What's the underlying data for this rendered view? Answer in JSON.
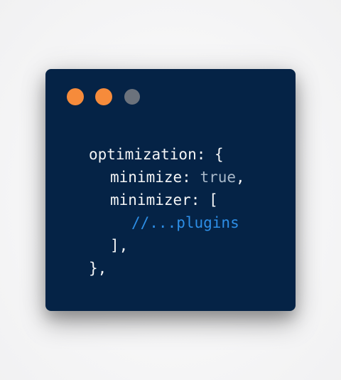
{
  "window": {
    "dots": [
      {
        "name": "orange-dot-1",
        "color": "#f68b3b"
      },
      {
        "name": "orange-dot-2",
        "color": "#f68b3b"
      },
      {
        "name": "gray-dot",
        "color": "#6b727c"
      }
    ]
  },
  "code": {
    "line1": "optimization: {",
    "line2_key": "minimize: ",
    "line2_value": "true",
    "line2_end": ",",
    "line3": "minimizer: [",
    "line4": "//...plugins",
    "line5": "],",
    "line6": "},"
  },
  "colors": {
    "background": "#f4f4f5",
    "window": "#052346",
    "text": "#f4f5f6",
    "value": "#a8b8c9",
    "comment": "#2d8ee6"
  }
}
